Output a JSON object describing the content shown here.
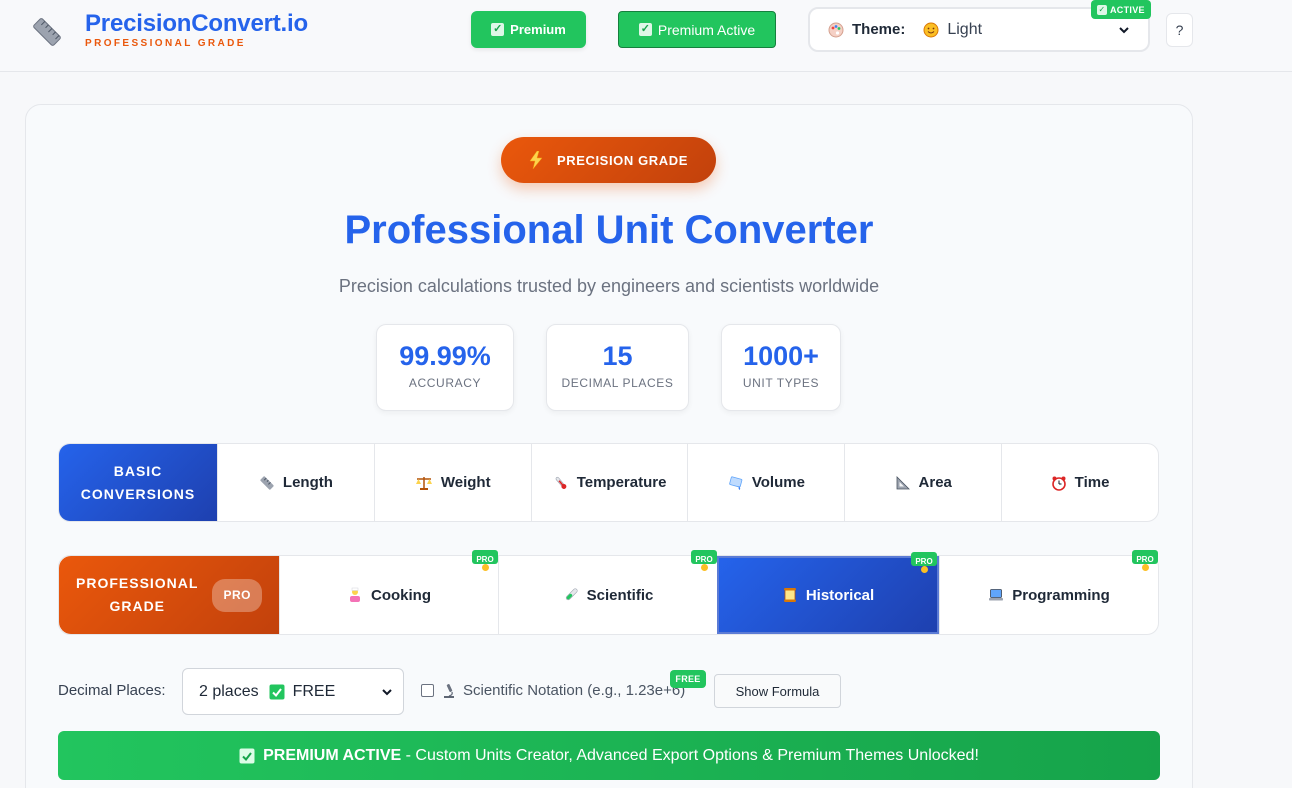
{
  "brand": {
    "name": "PrecisionConvert.io",
    "tagline": "PROFESSIONAL GRADE"
  },
  "header": {
    "premium_label": "Premium",
    "premium_active_label": "Premium Active",
    "theme_label": "Theme:",
    "theme_value": "Light",
    "active_badge": "ACTIVE",
    "help_label": "?"
  },
  "hero": {
    "pill_label": "PRECISION GRADE",
    "title": "Professional Unit Converter",
    "subtitle": "Precision calculations trusted by engineers and scientists worldwide"
  },
  "stats": [
    {
      "value": "99.99%",
      "label": "ACCURACY"
    },
    {
      "value": "15",
      "label": "DECIMAL PLACES"
    },
    {
      "value": "1000+",
      "label": "UNIT TYPES"
    }
  ],
  "basic": {
    "category_label_1": "BASIC",
    "category_label_2": "CONVERSIONS",
    "tabs": [
      {
        "label": "Length",
        "icon": "ruler-icon"
      },
      {
        "label": "Weight",
        "icon": "scale-icon"
      },
      {
        "label": "Temperature",
        "icon": "thermometer-icon"
      },
      {
        "label": "Volume",
        "icon": "droplet-icon"
      },
      {
        "label": "Area",
        "icon": "triangle-ruler-icon"
      },
      {
        "label": "Time",
        "icon": "alarm-clock-icon"
      }
    ]
  },
  "professional": {
    "category_label_1": "PROFESSIONAL",
    "category_label_2": "GRADE",
    "pro_badge": "PRO",
    "tabs": [
      {
        "label": "Cooking",
        "icon": "chef-icon",
        "badge": "PRO"
      },
      {
        "label": "Scientific",
        "icon": "test-tube-icon",
        "badge": "PRO"
      },
      {
        "label": "Historical",
        "icon": "scroll-icon",
        "badge": "PRO",
        "active": true
      },
      {
        "label": "Programming",
        "icon": "laptop-icon",
        "badge": "PRO"
      }
    ]
  },
  "controls": {
    "decimal_label": "Decimal Places:",
    "decimal_value": "2 places",
    "decimal_tier": "FREE",
    "scientific_label": "Scientific Notation (e.g., 1.23e+6)",
    "scientific_badge": "FREE",
    "formula_button": "Show Formula"
  },
  "banner": {
    "strong": "PREMIUM ACTIVE",
    "rest": "- Custom Units Creator, Advanced Export Options & Premium Themes Unlocked!"
  },
  "colors": {
    "primary_blue": "#2563eb",
    "accent_orange": "#ea580c",
    "success_green": "#22c55e"
  }
}
